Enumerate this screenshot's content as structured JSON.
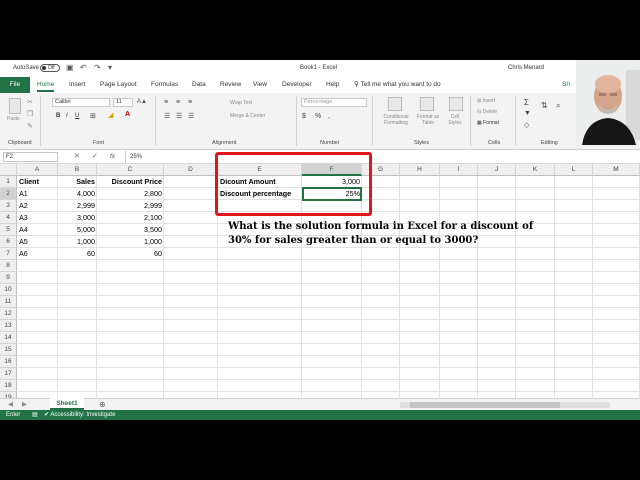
{
  "titlebar": {
    "autosave_label": "AutoSave",
    "autosave_state": "Off",
    "document_title": "Book1 - Excel",
    "user_name": "Chris Menard"
  },
  "tabs": [
    "File",
    "Home",
    "Insert",
    "Page Layout",
    "Formulas",
    "Data",
    "Review",
    "View",
    "Developer",
    "Help"
  ],
  "tell_me": "Tell me what you want to do",
  "ribbon": {
    "clipboard": {
      "label": "Clipboard",
      "paste": "Paste"
    },
    "font": {
      "label": "Font",
      "family": "Calibri",
      "size": "11",
      "bold": "B",
      "italic": "I",
      "underline": "U"
    },
    "alignment": {
      "label": "Alignment",
      "wrap_text": "Wrap Text",
      "merge_center": "Merge & Center"
    },
    "number": {
      "label": "Number",
      "format": "Percentage",
      "percent": "%",
      "comma": ","
    },
    "styles": {
      "label": "Styles",
      "conditional": "Conditional Formatting",
      "format_table": "Format as Table",
      "cell_styles": "Cell Styles"
    },
    "cells": {
      "label": "Cells",
      "insert": "Insert",
      "delete": "Delete",
      "format": "Format"
    },
    "editing": {
      "label": "Editing"
    },
    "ideas": {
      "label": "Ideas"
    },
    "share": "Sh"
  },
  "formula_bar": {
    "name_box": "F2",
    "fx": "fx",
    "value": "25%"
  },
  "columns": [
    "A",
    "B",
    "C",
    "D",
    "E",
    "F",
    "G",
    "H",
    "I",
    "J",
    "K",
    "L",
    "M"
  ],
  "rows": [
    "1",
    "2",
    "3",
    "4",
    "5",
    "6",
    "7",
    "8",
    "9",
    "10",
    "11",
    "12",
    "13",
    "14",
    "15",
    "16",
    "17",
    "18",
    "19"
  ],
  "table": {
    "headers": [
      "Client",
      "Sales",
      "Discount Price"
    ],
    "rows": [
      [
        "A1",
        "4,000",
        "2,800"
      ],
      [
        "A2",
        "2,999",
        "2,999"
      ],
      [
        "A3",
        "3,000",
        "2,100"
      ],
      [
        "A4",
        "5,000",
        "3,500"
      ],
      [
        "A5",
        "1,000",
        "1,000"
      ],
      [
        "A6",
        "60",
        "60"
      ]
    ]
  },
  "params": {
    "discount_amount_label": "Dicount Amount",
    "discount_amount_value": "3,000",
    "discount_percentage_label": "Discount percentage",
    "discount_percentage_value": "25%"
  },
  "question": "What is the solution formula in Excel for a discount of 30% for sales greater than or equal to 3000?",
  "sheet_tab": "Sheet1",
  "status": {
    "mode": "Enter",
    "accessibility": "Accessibility: Investigate"
  }
}
